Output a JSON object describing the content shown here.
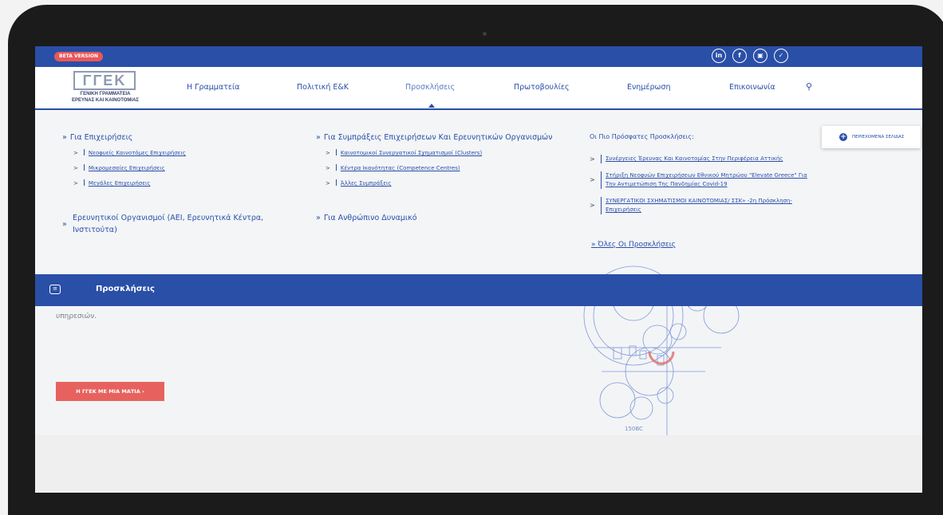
{
  "topbar": {
    "beta_label": "BETA VERSION",
    "social": [
      {
        "icon": "linkedin-icon",
        "glyph": "in"
      },
      {
        "icon": "facebook-icon",
        "glyph": "f"
      },
      {
        "icon": "youtube-icon",
        "glyph": "▣"
      },
      {
        "icon": "twitter-icon",
        "glyph": "✓"
      }
    ]
  },
  "logo": {
    "mark": "ΓΓΕΚ",
    "line1": "ΓΕΝΙΚΗ ΓΡΑΜΜΑΤΕΙΑ",
    "line2": "ΕΡΕΥΝΑΣ ΚΑΙ ΚΑΙΝΟΤΟΜΙΑΣ"
  },
  "nav": {
    "items": [
      {
        "label": "Η Γραμματεία"
      },
      {
        "label": "Πολιτική Ε&Κ"
      },
      {
        "label": "Προσκλήσεις"
      },
      {
        "label": "Πρωτοβουλίες"
      },
      {
        "label": "Ενημέρωση"
      },
      {
        "label": "Επικοινωνία"
      }
    ],
    "search_glyph": "⚲"
  },
  "mega": {
    "col1": {
      "heading": "Για Επιχειρήσεις",
      "links": [
        "Νεοφυείς Καινοτόμες Επιχειρήσεις",
        "Μικρομεσαίες Επιχειρήσεις",
        "Μεγάλες Επιχειρήσεις"
      ],
      "heading2_line1": "Ερευνητικοί Οργανισμοί (ΑΕΙ, Ερευνητικά Κέντρα,",
      "heading2_line2": "Ινστιτούτα)"
    },
    "col2": {
      "heading": "Για Συμπράξεις Επιχειρήσεων Και Ερευνητικών Οργανισμών",
      "links": [
        "Καινοτομικοί Συνεργατικοί Σχηματισμοί (Clusters)",
        "Κέντρα Ικανότητας (Competence Centres)",
        "Άλλες Συμπράξεις"
      ],
      "heading2": "Για Ανθρώπινο Δυναμικό"
    },
    "recent": {
      "heading": "Οι Πιο Πρόσφατες Προσκλήσεις:",
      "items": [
        {
          "line1": "Συνέργειες Έρευνας Και Καινοτομίας Στην Περιφέρεια Αττικής",
          "line2": ""
        },
        {
          "line1": "Στήριξη Νεοφυών Επιχειρήσεων Εθνικού Μητρώου \"Elevate Greece\" Για",
          "line2": "Την Αντιμετώπιση Της Πανδημίας Covid-19"
        },
        {
          "line1": "ΣΥΝΕΡΓΑΤΙΚΟΙ ΣΧΗΜΑΤΙΣΜΟΙ ΚΑΙΝΟΤΟΜΙΑΣ/ ΣΣΚ» -2η Πρόσκληση-",
          "line2": "Επιχειρήσεις"
        }
      ],
      "all_label": "Όλες Οι Προσκλήσεις"
    },
    "chevron": "»",
    "sub_chevron": ">"
  },
  "toc": {
    "label": "ΠΕΡΙΕΧΟΜΕΝΑ ΣΕΛΙΔΑΣ",
    "glyph": "+"
  },
  "band": {
    "title": "Προσκλήσεις",
    "icon_glyph": "≡"
  },
  "content": {
    "text": "υπηρεσιών.",
    "button_label": "Η ΓΓΕΚ ΜΕ ΜΙΑ ΜΑΤΙΑ  ›"
  },
  "art_label": "150BC",
  "colors": {
    "brand_blue": "#2a4fa7",
    "accent_red": "#e7625e",
    "beta_red": "#e8585a"
  }
}
